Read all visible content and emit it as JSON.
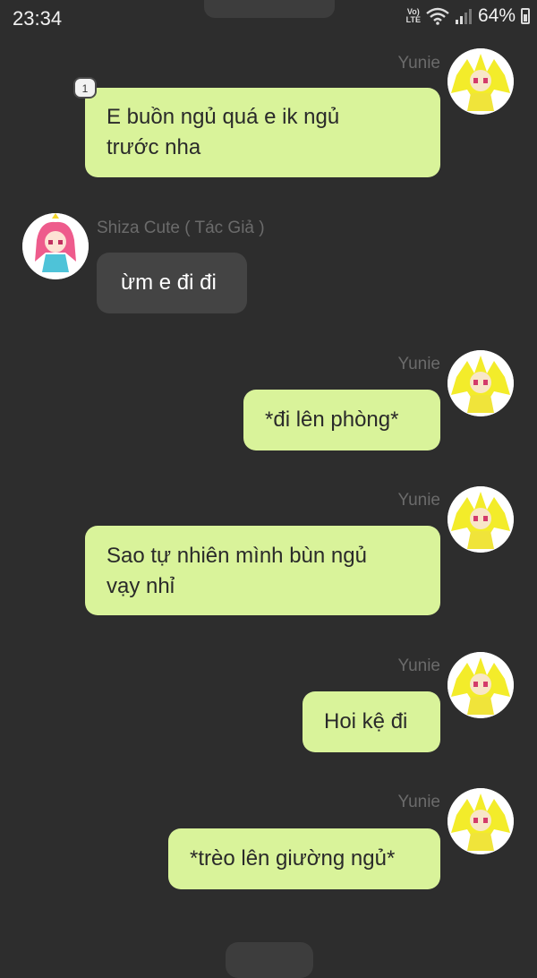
{
  "status_bar": {
    "time": "23:34",
    "network": "Vo) LTE",
    "battery": "64%"
  },
  "messages": [
    {
      "sender": "Yunie",
      "text_lines": [
        "E buồn ngủ quá e ik ngủ",
        "trước nha"
      ],
      "badge": "1"
    },
    {
      "sender": "Shiza Cute ( Tác Giả )",
      "text_lines": [
        "ừm e đi đi"
      ]
    },
    {
      "sender": "Yunie",
      "text_lines": [
        "*đi lên phòng*"
      ]
    },
    {
      "sender": "Yunie",
      "text_lines": [
        "Sao tự nhiên mình bùn ngủ",
        "vạy nhỉ"
      ]
    },
    {
      "sender": "Yunie",
      "text_lines": [
        "Hoi kệ đi"
      ]
    },
    {
      "sender": "Yunie",
      "text_lines": [
        "*trèo lên giường ngủ*"
      ]
    }
  ],
  "colors": {
    "background": "#2d2d2d",
    "outgoing_bubble": "#d9f39a",
    "incoming_bubble": "#444444",
    "name": "#6b6b6b"
  },
  "icons": [
    "wifi-icon",
    "signal-icon",
    "battery-icon",
    "avatar-yunie",
    "avatar-shiza"
  ]
}
